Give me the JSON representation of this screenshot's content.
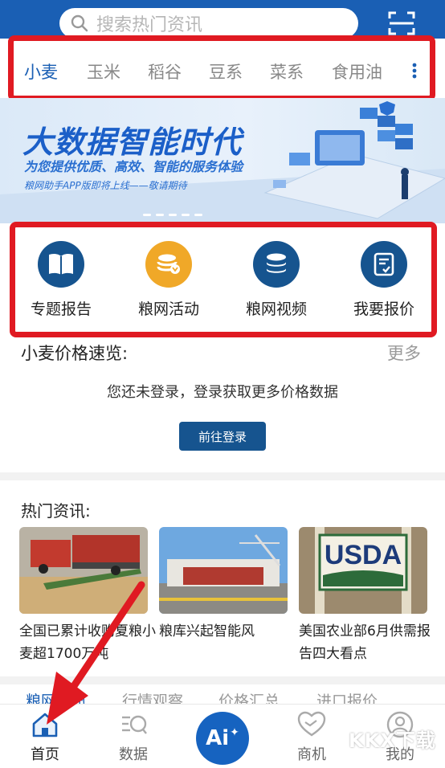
{
  "search": {
    "placeholder": "搜索热门资讯"
  },
  "tabs": [
    "小麦",
    "玉米",
    "稻谷",
    "豆系",
    "菜系",
    "食用油"
  ],
  "banner": {
    "title": "大数据智能时代",
    "subtitle": "为您提供优质、高效、智能的服务体验",
    "note": "粮网助手APP版即将上线——敬请期待"
  },
  "quick": [
    "专题报告",
    "粮网活动",
    "粮网视频",
    "我要报价"
  ],
  "price": {
    "title": "小麦价格速览:",
    "more": "更多",
    "message": "您还未登录，登录获取更多价格数据",
    "login_button": "前往登录"
  },
  "hot": {
    "title": "热门资讯:",
    "items": [
      {
        "text": "全国已累计收购夏粮小麦超1700万吨"
      },
      {
        "text": "粮库兴起智能风"
      },
      {
        "text": "美国农业部6月供需报告四大看点",
        "thumb_text": "USDA"
      }
    ]
  },
  "subtabs": [
    "粮网资讯",
    "行情观察",
    "价格汇总",
    "进口报价"
  ],
  "nav": [
    "首页",
    "数据",
    "商机",
    "我的"
  ],
  "ai_label": "Ai",
  "watermark": "KKX下载",
  "colors": {
    "brand": "#1a5fb4",
    "highlight": "#e01a22",
    "gold": "#f0a828"
  }
}
